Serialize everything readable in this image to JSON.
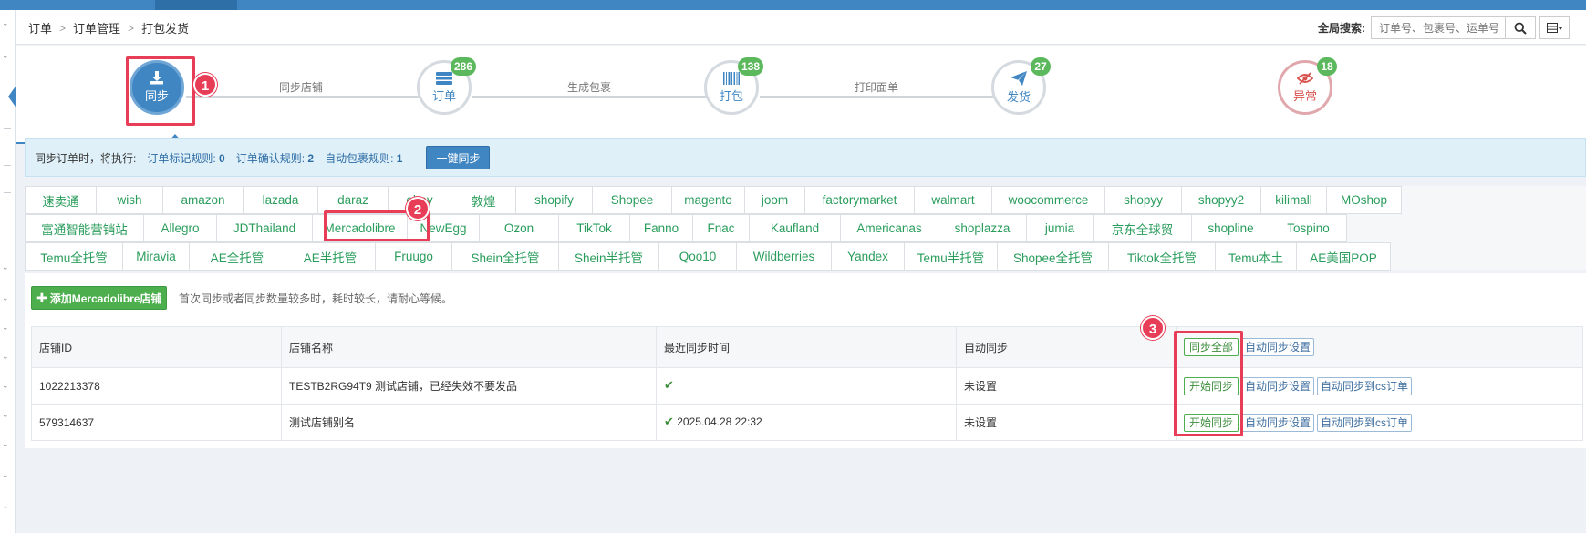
{
  "breadcrumb": [
    "订单",
    "订单管理",
    "打包发货"
  ],
  "global_search": {
    "label": "全局搜索:",
    "placeholder": "订单号、包裹号、运单号"
  },
  "steps": {
    "sync": {
      "label": "同步"
    },
    "order": {
      "label": "订单",
      "badge": "286"
    },
    "pack": {
      "label": "打包",
      "badge": "138"
    },
    "ship": {
      "label": "发货",
      "badge": "27"
    },
    "exception": {
      "label": "异常",
      "badge": "18"
    },
    "connectors": [
      "同步店铺",
      "生成包裹",
      "打印面单"
    ]
  },
  "annotations": [
    "1",
    "2",
    "3"
  ],
  "info": {
    "prefix": "同步订单时，将执行:",
    "rules": [
      {
        "label": "订单标记规则:",
        "value": "0"
      },
      {
        "label": "订单确认规则:",
        "value": "2"
      },
      {
        "label": "自动包裹规则:",
        "value": "1"
      }
    ],
    "button": "一键同步"
  },
  "platform_tabs": [
    [
      "速卖通",
      "wish",
      "amazon",
      "lazada",
      "daraz",
      "ebay",
      "敦煌",
      "shopify",
      "Shopee",
      "magento",
      "joom",
      "factorymarket",
      "walmart",
      "woocommerce",
      "shopyy",
      "shopyy2",
      "kilimall",
      "MOshop"
    ],
    [
      "富通智能营销站",
      "Allegro",
      "JDThailand",
      "Mercadolibre",
      "NewEgg",
      "Ozon",
      "TikTok",
      "Fanno",
      "Fnac",
      "Kaufland",
      "Americanas",
      "shoplazza",
      "jumia",
      "京东全球贸",
      "shopline",
      "Tospino"
    ],
    [
      "Temu全托管",
      "Miravia",
      "AE全托管",
      "AE半托管",
      "Fruugo",
      "Shein全托管",
      "Shein半托管",
      "Qoo10",
      "Wildberries",
      "Yandex",
      "Temu半托管",
      "Shopee全托管",
      "Tiktok全托管",
      "Temu本土",
      "AE美国POP"
    ]
  ],
  "add_store_button": "添加Mercadolibre店铺",
  "hint": "首次同步或者同步数量较多时，耗时较长，请耐心等候。",
  "table": {
    "headers": [
      "店铺ID",
      "店铺名称",
      "最近同步时间",
      "自动同步"
    ],
    "header_actions": [
      "同步全部",
      "自动同步设置"
    ],
    "rows": [
      {
        "id": "1022213378",
        "name": "TESTB2RG94T9 测试店铺，已经失效不要发品",
        "last_sync": "",
        "auto": "未设置",
        "actions": [
          "开始同步",
          "自动同步设置",
          "自动同步到cs订单"
        ]
      },
      {
        "id": "579314637",
        "name": "测试店铺别名",
        "last_sync": "2025.04.28 22:32",
        "auto": "未设置",
        "actions": [
          "开始同步",
          "自动同步设置",
          "自动同步到cs订单"
        ]
      }
    ]
  },
  "colors": {
    "primary": "#3f86c2",
    "success": "#4cae4c",
    "highlight": "#e83d56",
    "tab_text": "#2a9d5c"
  },
  "icons": [
    "download-icon",
    "order-icon",
    "barcode-icon",
    "paper-plane-icon",
    "eye-slash-icon",
    "search-icon",
    "columns-icon",
    "check-icon",
    "plus-icon"
  ]
}
